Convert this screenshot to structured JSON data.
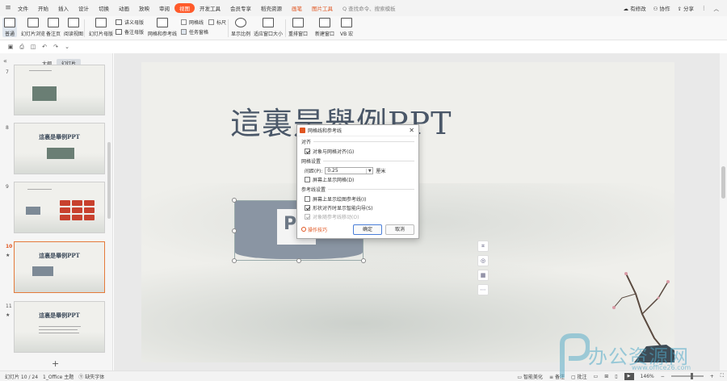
{
  "menu": {
    "items": [
      "文件",
      "开始",
      "插入",
      "设计",
      "切换",
      "动画",
      "放映",
      "审阅",
      "视图",
      "开发工具",
      "会员专享",
      "稻壳资源",
      "画笔",
      "图片工具"
    ],
    "active": "视图",
    "search_placeholder": "Q 查找命令、搜索模板",
    "right": {
      "cloud": "有修改",
      "collab": "协作",
      "share": "分享"
    }
  },
  "ribbon": {
    "normal": "普通",
    "slide_browse": "幻灯片浏览",
    "notes_page": "备注页",
    "reading_view": "阅读视图",
    "slide_master": "幻灯片母版",
    "handout_master": "讲义母版",
    "notes_master": "备注母版",
    "grid_guides": "网格和参考线",
    "gridlines": "网格线",
    "ruler": "标尺",
    "task_pane": "任务窗格",
    "show_ratio": "显示比例",
    "fit_window": "适应窗口大小",
    "arrange_window": "重排窗口",
    "new_window": "新建窗口",
    "vb_macro": "VB 宏"
  },
  "quickaccess": [
    "保存",
    "打印",
    "预览",
    "撤销",
    "恢复",
    "更多"
  ],
  "leftpane": {
    "tab_outline": "大纲",
    "tab_slides": "幻灯片",
    "thumbs": [
      {
        "num": "7",
        "title": ""
      },
      {
        "num": "8",
        "title": "這裏是舉例PPT"
      },
      {
        "num": "9",
        "title": ""
      },
      {
        "num": "10",
        "title": "這裏是舉例PPT",
        "current": true
      },
      {
        "num": "11",
        "title": "這裏是舉例PPT"
      }
    ],
    "add_label": "+"
  },
  "slide": {
    "title": "這裏是舉例PPT",
    "shape_text": "P"
  },
  "dialog": {
    "title": "网格线和参考线",
    "section_align": "对齐",
    "snap_grid": "对象与网格对齐(G)",
    "section_grid": "网格设置",
    "spacing_label": "间距(P):",
    "spacing_value": "0.25",
    "spacing_unit": "厘米",
    "show_grid": "屏幕上显示网格(D)",
    "section_guides": "参考线设置",
    "show_drawing_guides": "屏幕上显示绘图参考线(I)",
    "smart_guides": "形状对齐时显示智能向导(S)",
    "object_follow": "对象随参考线移动(O)",
    "tips": "操作技巧",
    "ok": "确定",
    "cancel": "取消",
    "checks": {
      "snap_grid": true,
      "show_grid": false,
      "show_drawing_guides": false,
      "smart_guides": true,
      "object_follow": true
    }
  },
  "statusbar": {
    "slide_pos": "幻灯片 10 / 24",
    "theme": "1_Office 主题",
    "missing_font": "缺失字体",
    "smart_beautify": "智能美化",
    "notes": "备注",
    "comments": "批注",
    "zoom": "146%"
  },
  "watermark": {
    "text": "办公资源网",
    "url": "www.office26.com"
  },
  "colors": {
    "accent": "#ff5a2a",
    "title_ink": "#4a5768",
    "shape": "#8a95a3"
  }
}
